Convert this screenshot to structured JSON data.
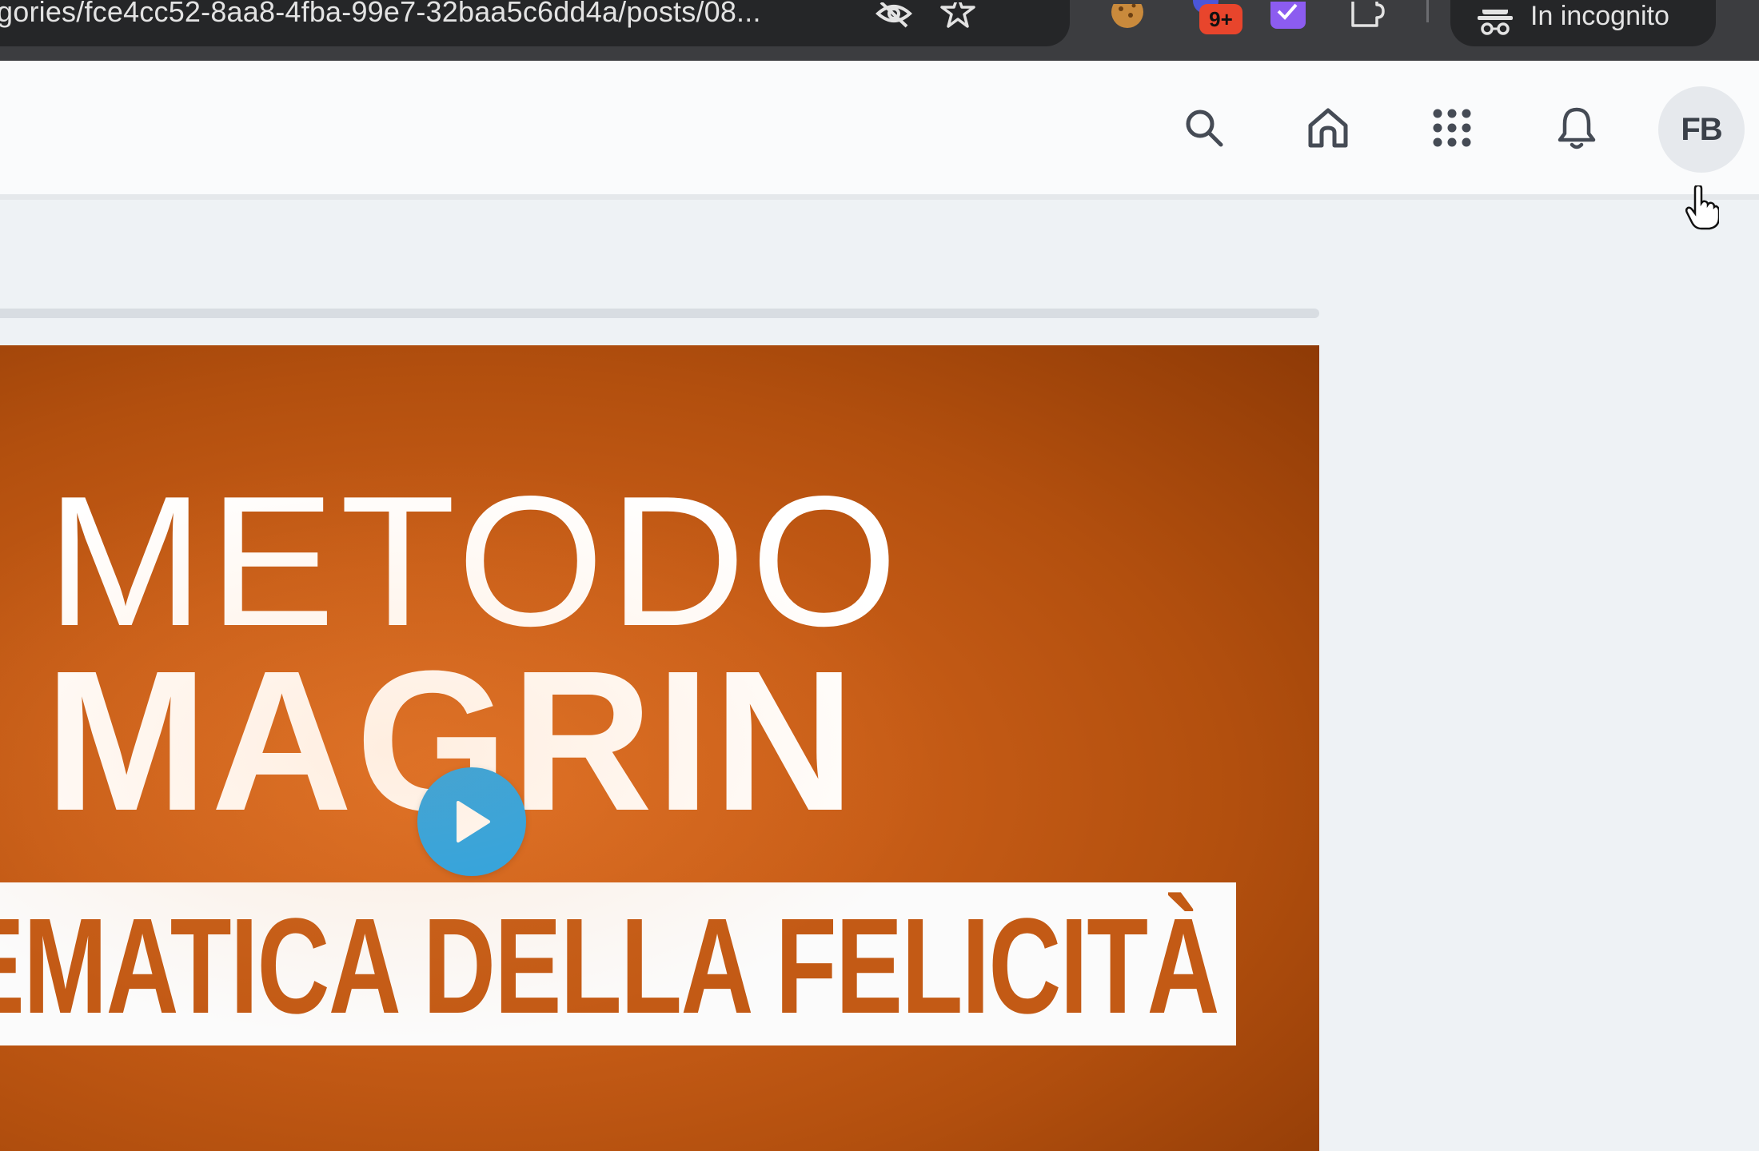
{
  "browser": {
    "url": "gories/fce4cc52-8aa8-4fba-99e7-32baa5c6dd4a/posts/08...",
    "extension_badge": "9+",
    "incognito_label": "In incognito",
    "icons": [
      "eye-off-icon",
      "star-icon",
      "cookie-icon",
      "extension-badge-icon",
      "checkbox-extension-icon",
      "puzzle-icon",
      "incognito-icon"
    ]
  },
  "header": {
    "icons": [
      "search-icon",
      "home-icon",
      "apps-grid-icon",
      "bell-icon"
    ],
    "avatar_initials": "FB"
  },
  "video": {
    "title_line1": "METODO",
    "title_line2": "MAGRIN",
    "banner": "TEMATICA DELLA FELICITÀ",
    "play_icon": "play-icon"
  },
  "colors": {
    "chrome_bg": "#3c3d40",
    "header_bg": "#fafbfc",
    "content_bg": "#eef2f5",
    "video_orange": "#c85d17",
    "banner_text": "#c35a15",
    "play_blue": "#22a4ea"
  }
}
